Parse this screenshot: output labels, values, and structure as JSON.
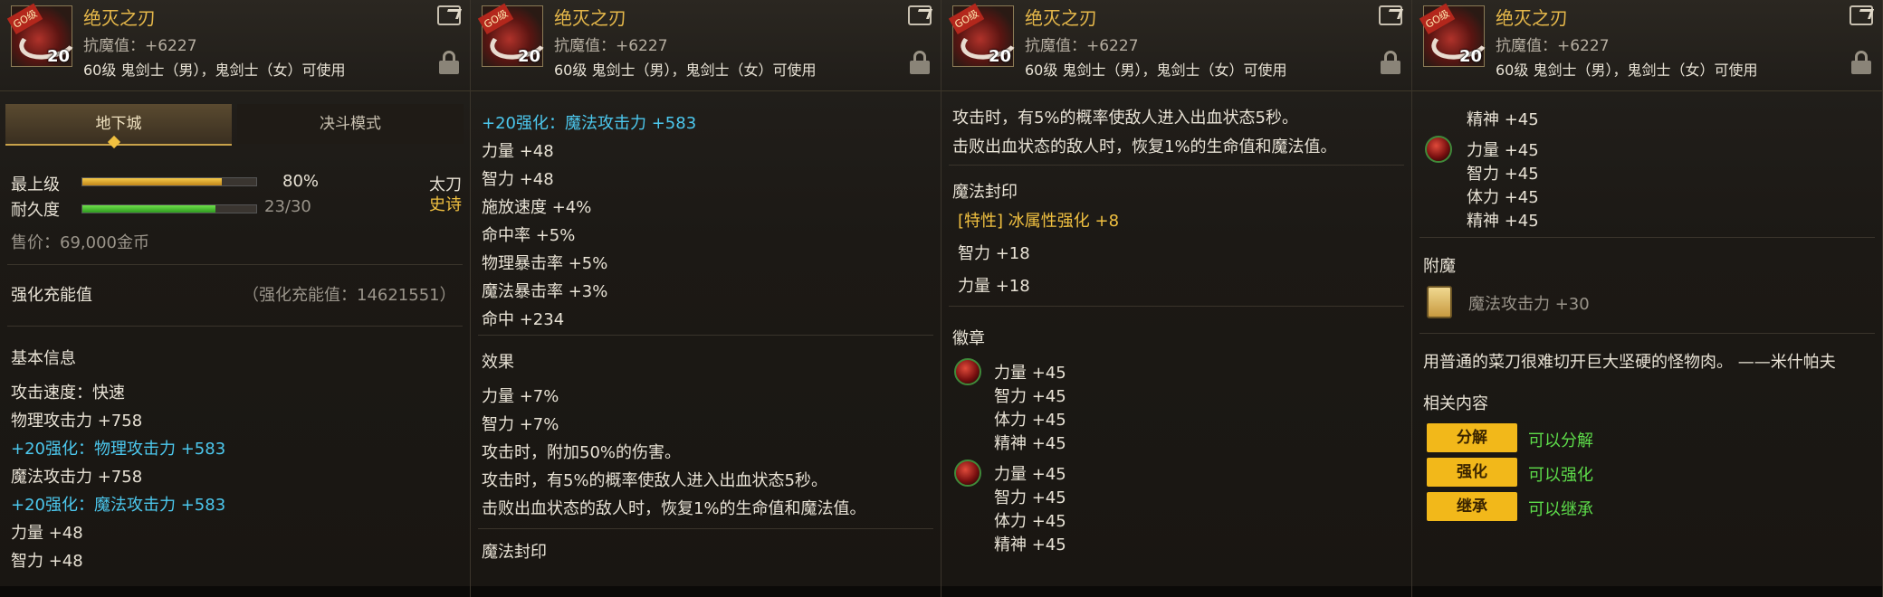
{
  "item": {
    "name": "绝灭之刃",
    "level_badge": "20",
    "rarity_tag": "史诗",
    "icon_tag": "GO级",
    "anti_magic": "抗魔值：+6227",
    "usable": "60级 鬼剑士（男），鬼剑士（女）可使用"
  },
  "panel1": {
    "tab_dungeon": "地下城",
    "tab_duel": "决斗模式",
    "top_grade_label": "最上级",
    "top_grade_value": "80%",
    "top_grade_fraction": 0.8,
    "durability_label": "耐久度",
    "durability_value": "23/30",
    "durability_fraction": 0.767,
    "weapon_type": "太刀",
    "rarity": "史诗",
    "price": "售价：69,000金币",
    "charge_label": "强化充能值",
    "charge_value": "（强化充能值：14621551）",
    "basic_info": "基本信息",
    "lines": [
      {
        "text": "攻击速度：快速",
        "cls": ""
      },
      {
        "text": "物理攻击力 +758",
        "cls": ""
      },
      {
        "text": "+20强化：物理攻击力 +583",
        "cls": "cyan"
      },
      {
        "text": "魔法攻击力 +758",
        "cls": ""
      },
      {
        "text": "+20强化：魔法攻击力 +583",
        "cls": "cyan"
      },
      {
        "text": "力量 +48",
        "cls": ""
      },
      {
        "text": "智力 +48",
        "cls": ""
      }
    ]
  },
  "panel2": {
    "lines": [
      {
        "text": "+20强化：魔法攻击力 +583",
        "cls": "cyan"
      },
      {
        "text": "力量 +48",
        "cls": ""
      },
      {
        "text": "智力 +48",
        "cls": ""
      },
      {
        "text": "施放速度 +4%",
        "cls": ""
      },
      {
        "text": "命中率 +5%",
        "cls": ""
      },
      {
        "text": "物理暴击率 +5%",
        "cls": ""
      },
      {
        "text": "魔法暴击率 +3%",
        "cls": ""
      },
      {
        "text": "命中 +234",
        "cls": ""
      }
    ],
    "effect_head": "效果",
    "effects": [
      "力量 +7%",
      "智力 +7%",
      "攻击时，附加50%的伤害。",
      "攻击时，有5%的概率使敌人进入出血状态5秒。",
      "击败出血状态的敌人时，恢复1%的生命值和魔法值。"
    ],
    "seal_head": "魔法封印"
  },
  "panel3": {
    "effects": [
      "攻击时，有5%的概率使敌人进入出血状态5秒。",
      "击败出血状态的敌人时，恢复1%的生命值和魔法值。"
    ],
    "seal_head": "魔法封印",
    "seal_special": "[特性] 冰属性强化 +8",
    "seal_int": "智力 +18",
    "seal_str": "力量 +18",
    "badge_head": "徽章",
    "badge1": [
      "力量 +45",
      "智力 +45",
      "体力 +45",
      "精神 +45"
    ],
    "badge2": [
      "力量 +45",
      "智力 +45",
      "体力 +45",
      "精神 +45"
    ]
  },
  "panel4": {
    "badge_top": [
      "精神 +45"
    ],
    "badge2": [
      "力量 +45",
      "智力 +45",
      "体力 +45",
      "精神 +45"
    ],
    "enchant_head": "附魔",
    "enchant_value": "魔法攻击力 +30",
    "flavor": "用普通的菜刀很难切开巨大坚硬的怪物肉。 ——米什帕夫",
    "related_head": "相关内容",
    "buttons": [
      {
        "label": "分解",
        "desc": "可以分解"
      },
      {
        "label": "强化",
        "desc": "可以强化"
      },
      {
        "label": "继承",
        "desc": "可以继承"
      }
    ]
  },
  "colors": {
    "title": "#e6b84a",
    "cyan": "#4cc8ee",
    "yellow": "#f0c040",
    "green": "#5ddc4a",
    "button": "#f2b81a"
  }
}
